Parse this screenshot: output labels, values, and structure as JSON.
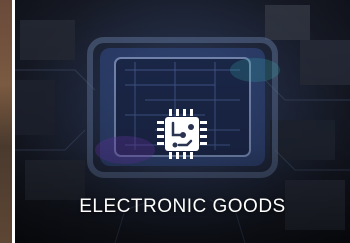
{
  "category_card": {
    "label": "ELECTRONIC GOODS",
    "icon": "circuit-chip-icon",
    "accent_color": "#ffffff"
  }
}
